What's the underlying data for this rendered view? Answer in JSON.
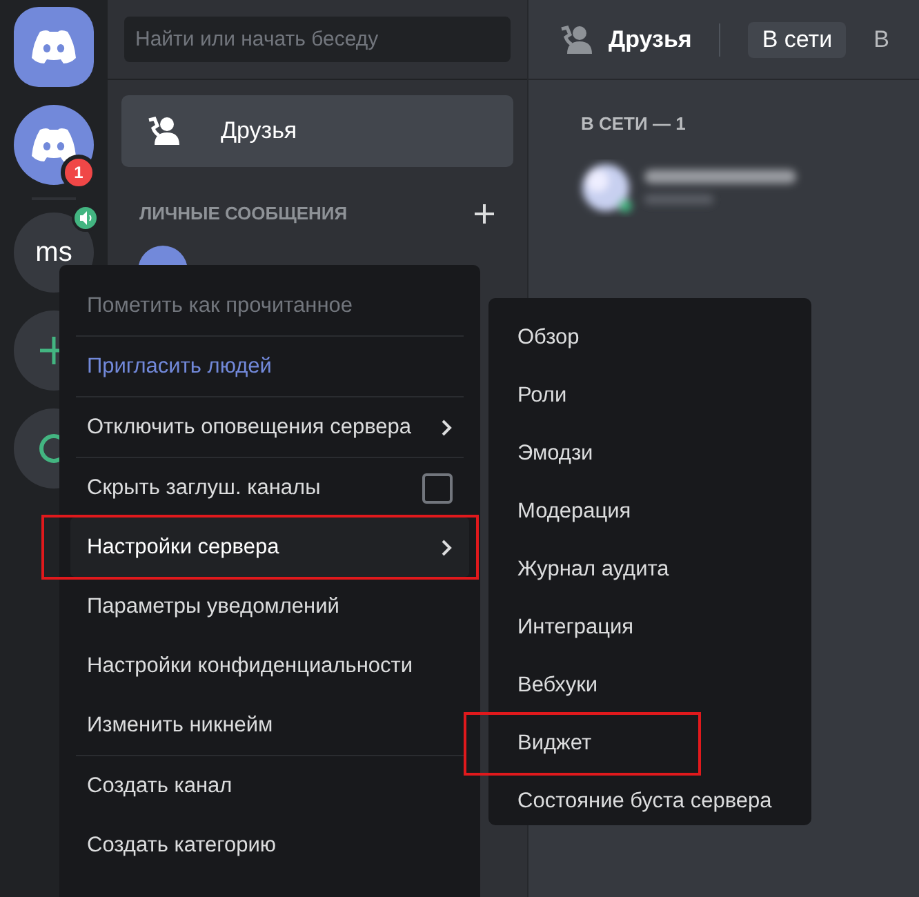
{
  "rail": {
    "items": [
      {
        "kind": "logo"
      },
      {
        "kind": "logo",
        "badge": "1"
      },
      {
        "kind": "initials",
        "label": "ms",
        "voice": true
      },
      {
        "kind": "add"
      },
      {
        "kind": "explore"
      }
    ]
  },
  "search": {
    "placeholder": "Найти или начать беседу"
  },
  "sidebar": {
    "items": [
      {
        "label": "Друзья",
        "selected": true
      }
    ],
    "section": "ЛИЧНЫЕ СООБЩЕНИЯ"
  },
  "header": {
    "title": "Друзья",
    "tabs": [
      {
        "label": "В сети",
        "selected": true
      },
      {
        "label": "В",
        "selected": false
      }
    ]
  },
  "online": {
    "heading": "В СЕТИ — 1"
  },
  "context_menu": {
    "items": [
      {
        "kind": "plain",
        "label": "Пометить как прочитанное",
        "disabled": true,
        "hovered": false,
        "highlighted": false
      },
      {
        "kind": "link",
        "label": "Пригласить людей",
        "disabled": false,
        "hovered": false,
        "highlighted": false
      },
      {
        "kind": "submenu",
        "label": "Отключить оповещения сервера",
        "disabled": false,
        "hovered": false,
        "highlighted": false
      },
      {
        "kind": "checkbox",
        "label": "Скрыть заглуш. каналы",
        "checked": false,
        "disabled": false,
        "hovered": false,
        "highlighted": false
      },
      {
        "kind": "submenu",
        "label": "Настройки сервера",
        "disabled": false,
        "hovered": true,
        "highlighted": true
      },
      {
        "kind": "plain",
        "label": "Параметры уведомлений",
        "disabled": false,
        "hovered": false,
        "highlighted": false
      },
      {
        "kind": "plain",
        "label": "Настройки конфиденциальности",
        "disabled": false,
        "hovered": false,
        "highlighted": false
      },
      {
        "kind": "plain",
        "label": "Изменить никнейм",
        "disabled": false,
        "hovered": false,
        "highlighted": false
      },
      {
        "kind": "plain",
        "label": "Создать канал",
        "disabled": false,
        "hovered": false,
        "highlighted": false
      },
      {
        "kind": "plain",
        "label": "Создать категорию",
        "disabled": false,
        "hovered": false,
        "highlighted": false
      }
    ]
  },
  "submenu": {
    "items": [
      {
        "label": "Обзор",
        "highlighted": false
      },
      {
        "label": "Роли",
        "highlighted": false
      },
      {
        "label": "Эмодзи",
        "highlighted": false
      },
      {
        "label": "Модерация",
        "highlighted": false
      },
      {
        "label": "Журнал аудита",
        "highlighted": false
      },
      {
        "label": "Интеграция",
        "highlighted": false
      },
      {
        "label": "Вебхуки",
        "highlighted": false
      },
      {
        "label": "Виджет",
        "highlighted": true
      },
      {
        "label": "Состояние буста сервера",
        "highlighted": false
      }
    ]
  }
}
